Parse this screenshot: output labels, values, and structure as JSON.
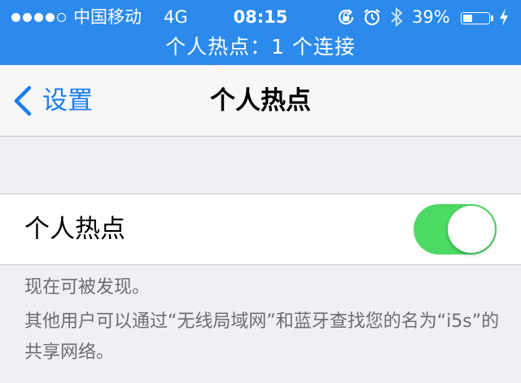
{
  "status_bar": {
    "signal_dots_filled": 4,
    "signal_dots_total": 5,
    "carrier": "中国移动",
    "network": "4G",
    "time": "08:15",
    "icons": [
      "rotation-lock-icon",
      "alarm-icon",
      "bluetooth-icon",
      "charging-bolt-icon"
    ],
    "battery_percent": "39%",
    "battery_level": 0.39,
    "hotspot_banner": "个人热点：1 个连接",
    "color": "#2b8aeb"
  },
  "nav": {
    "back_label": "设置",
    "title": "个人热点",
    "accent": "#1a7ff0"
  },
  "hotspot_row": {
    "label": "个人热点",
    "toggle_on": true,
    "toggle_color": "#4cd964"
  },
  "notes": {
    "discoverable": "现在可被发现。",
    "description": "其他用户可以通过“无线局域网”和蓝牙查找您的名为“i5s”的共享网络。"
  },
  "annotation": {
    "scribble_color": "#e0262e"
  }
}
